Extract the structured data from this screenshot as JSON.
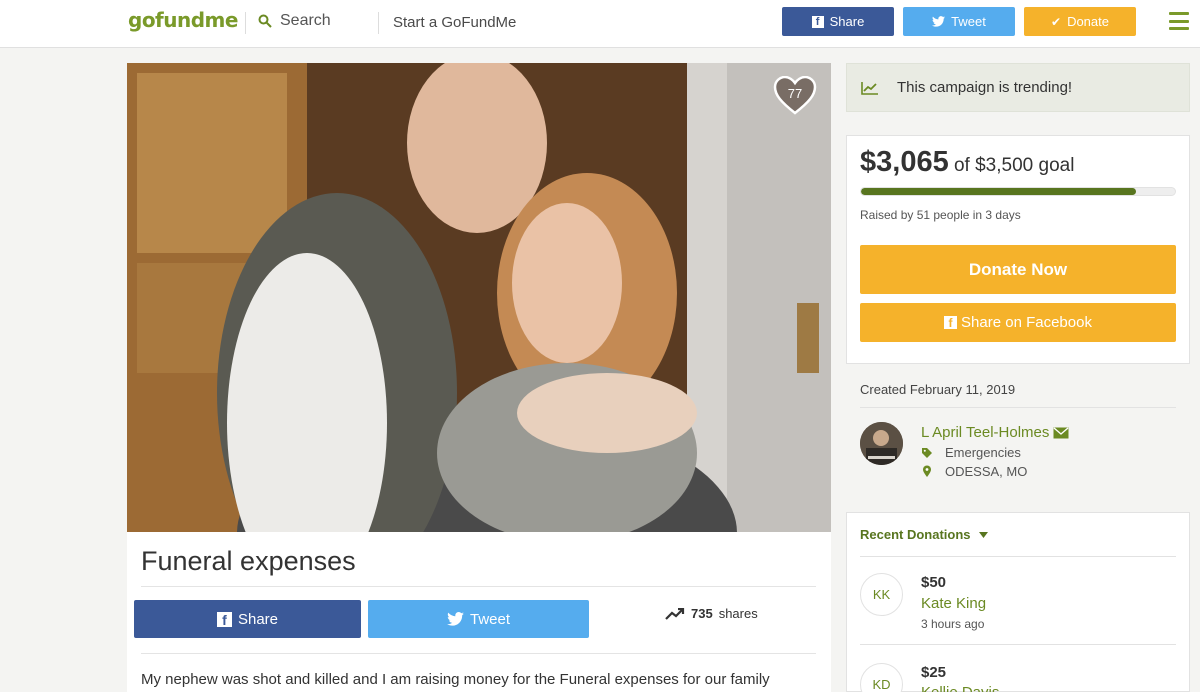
{
  "header": {
    "logo": "gofundme",
    "search_label": "Search",
    "start_label": "Start a GoFundMe",
    "share_label": "Share",
    "tweet_label": "Tweet",
    "donate_label": "Donate"
  },
  "campaign": {
    "heart_count": "77",
    "title": "Funeral expenses",
    "share_label": "Share",
    "tweet_label": "Tweet",
    "shares_count": "735",
    "shares_suffix": "shares",
    "story": "My nephew was shot and killed and I am raising money for the Funeral expenses for our family"
  },
  "sidebar": {
    "trending": "This campaign is trending!",
    "raised_amount": "$3,065",
    "goal_text": "of $3,500 goal",
    "progress_fraction": 0.876,
    "raised_by": "Raised by 51 people in 3 days",
    "donate_now": "Donate Now",
    "share_facebook": "Share on Facebook",
    "created": "Created February 11, 2019",
    "organizer": "L April Teel-Holmes",
    "category": "Emergencies",
    "location": "ODESSA, MO",
    "recent_header": "Recent Donations",
    "donations": [
      {
        "initials": "KK",
        "amount": "$50",
        "name": "Kate King",
        "time": "3 hours ago"
      },
      {
        "initials": "KD",
        "amount": "$25",
        "name": "Kellie Davis",
        "time": ""
      }
    ]
  },
  "colors": {
    "brand_green": "#6b8a23",
    "facebook": "#3b5998",
    "twitter": "#55acee",
    "donate_orange": "#f5b22b"
  }
}
